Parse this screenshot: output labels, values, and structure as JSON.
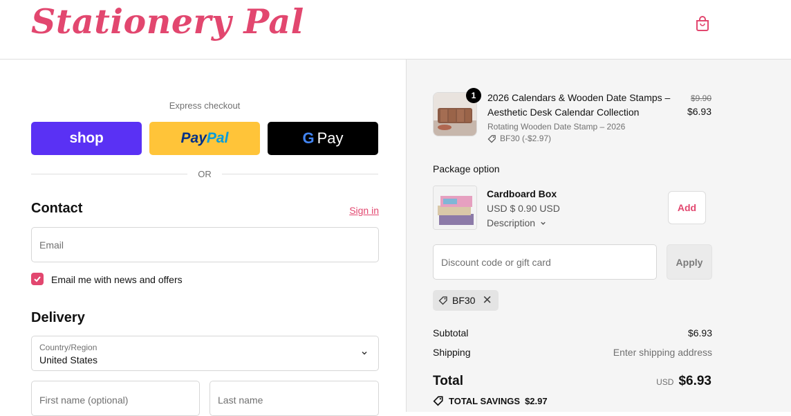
{
  "header": {
    "logo_text": "Stationery Pal",
    "cart_icon": "shopping-bag-icon"
  },
  "express": {
    "label": "Express checkout",
    "shop_label": "shop",
    "paypal_part1": "Pay",
    "paypal_part2": "Pal",
    "gpay_g": "G",
    "gpay_label": "Pay",
    "or_label": "OR"
  },
  "contact": {
    "title": "Contact",
    "signin_label": "Sign in",
    "email_placeholder": "Email",
    "newsletter_label": "Email me with news and offers",
    "newsletter_checked": true
  },
  "delivery": {
    "title": "Delivery",
    "country_label": "Country/Region",
    "country_value": "United States",
    "first_name_placeholder": "First name (optional)",
    "last_name_placeholder": "Last name"
  },
  "order": {
    "item": {
      "quantity": "1",
      "title": "2026 Calendars & Wooden Date Stamps – Aesthetic Desk Calendar Collection",
      "variant": "Rotating Wooden Date Stamp – 2026",
      "discount": "BF30 (-$2.97)",
      "price_original": "$9.90",
      "price_final": "$6.93"
    },
    "package": {
      "label": "Package option",
      "name": "Cardboard Box",
      "price": "USD $ 0.90 USD",
      "description_label": "Description",
      "add_label": "Add"
    },
    "discount": {
      "placeholder": "Discount code or gift card",
      "apply_label": "Apply",
      "applied_code": "BF30"
    },
    "summary": {
      "subtotal_label": "Subtotal",
      "subtotal_value": "$6.93",
      "shipping_label": "Shipping",
      "shipping_value": "Enter shipping address",
      "total_label": "Total",
      "total_currency": "USD",
      "total_value": "$6.93",
      "savings_label": "TOTAL SAVINGS",
      "savings_value": "$2.97"
    }
  },
  "colors": {
    "brand": "#e2476f",
    "shop_pay": "#5a31f4",
    "paypal": "#ffc439",
    "gpay": "#000000",
    "summary_bg": "#f5f5f5"
  }
}
